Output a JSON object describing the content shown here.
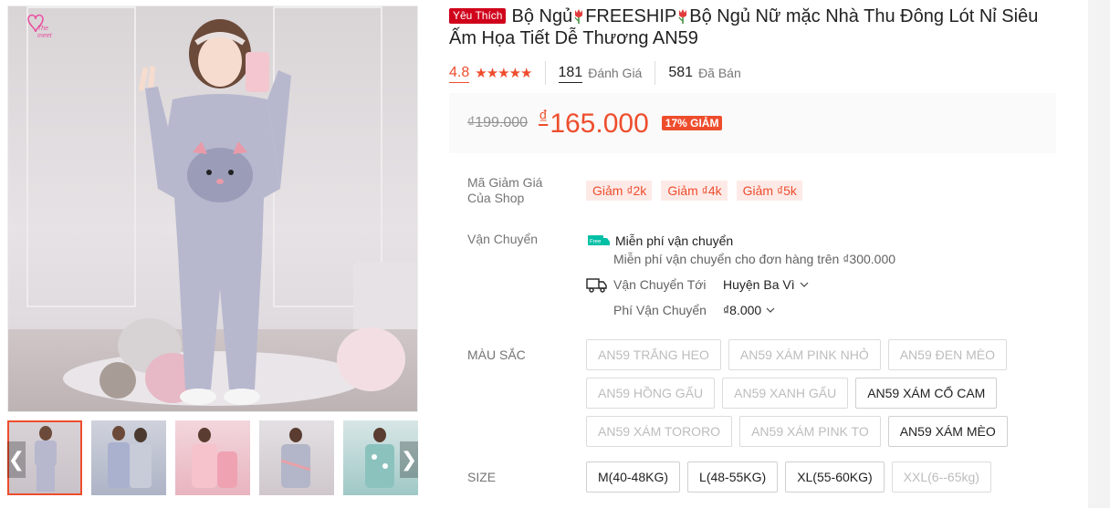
{
  "gallery": {
    "shop_logo_text": "The meet",
    "nav_left_glyph": "❮",
    "nav_right_glyph": "❯",
    "thumb_count": 5,
    "colors": {
      "accent": "#ee4d2d"
    }
  },
  "product": {
    "badge": "Yêu Thích",
    "title_part1": "Bộ Ngủ",
    "title_part2": "FREESHIP",
    "title_part3": "Bộ Ngủ Nữ mặc Nhà Thu Đông Lót Nỉ Siêu Ấm Họa Tiết Dễ Thương AN59",
    "rating": "4.8",
    "stars": "★★★★★",
    "reviews_count": "181",
    "reviews_label": "Đánh Giá",
    "sold_count": "581",
    "sold_label": "Đã Bán"
  },
  "price": {
    "original": "₫199.000",
    "currency": "₫",
    "current": "165.000",
    "discount": "17% GIẢM"
  },
  "vouchers": {
    "label": "Mã Giảm Giá Của Shop",
    "items": [
      "Giảm ₫2k",
      "Giảm ₫4k",
      "Giảm ₫5k"
    ]
  },
  "shipping": {
    "label": "Vận Chuyển",
    "free_title": "Miễn phí vận chuyển",
    "free_sub": "Miễn phí vận chuyển cho đơn hàng trên ₫300.000",
    "to_label": "Vận Chuyển Tới",
    "to_value": "Huyện Ba Vì",
    "fee_label": "Phí Vận Chuyển",
    "fee_value": "₫8.000"
  },
  "color_option": {
    "label": "MÀU SẮC",
    "items": [
      {
        "label": "AN59 TRẮNG HEO",
        "enabled": false
      },
      {
        "label": "AN59 XÁM PINK NHỎ",
        "enabled": false
      },
      {
        "label": "AN59 ĐEN MÈO",
        "enabled": false
      },
      {
        "label": "AN59 HỒNG GẤU",
        "enabled": false
      },
      {
        "label": "AN59 XANH GẤU",
        "enabled": false
      },
      {
        "label": "AN59 XÁM CỔ CAM",
        "enabled": true
      },
      {
        "label": "AN59 XÁM TORORO",
        "enabled": false
      },
      {
        "label": "AN59 XÁM PINK TO",
        "enabled": false
      },
      {
        "label": "AN59 XÁM MÈO",
        "enabled": true
      }
    ]
  },
  "size_option": {
    "label": "SIZE",
    "items": [
      {
        "label": "M(40-48KG)",
        "enabled": true
      },
      {
        "label": "L(48-55KG)",
        "enabled": true
      },
      {
        "label": "XL(55-60KG)",
        "enabled": true
      },
      {
        "label": "XXL(6--65kg)",
        "enabled": false
      }
    ]
  }
}
